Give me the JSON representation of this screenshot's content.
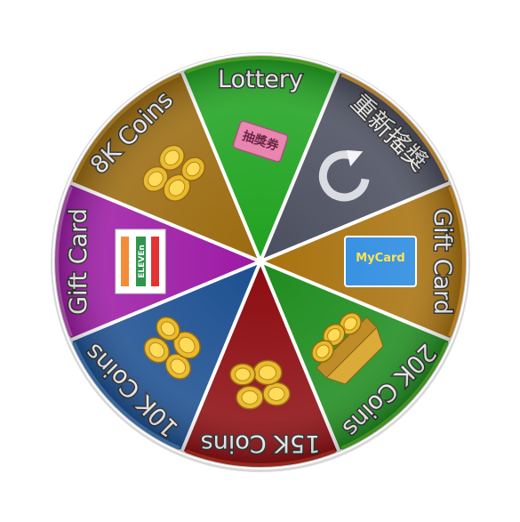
{
  "wheel": {
    "segments": [
      {
        "label": "Lottery",
        "color": "#1fa21f",
        "rim": "#5ac82a",
        "icon": "lottery-ticket-icon",
        "ticket_text": "抽獎券"
      },
      {
        "label": "重新搖獎",
        "color": "#4b4e5e",
        "rim": "#e0a040",
        "icon": "refresh-icon"
      },
      {
        "label": "Gift Card",
        "color": "#a8720e",
        "rim": "#e8a030",
        "icon": "mycard-icon",
        "card_text": "MyCard"
      },
      {
        "label": "20K Coins",
        "color": "#1e8c1e",
        "rim": "#56b82a",
        "icon": "gold-bar-coins-icon"
      },
      {
        "label": "15K Coins",
        "color": "#8c0c10",
        "rim": "#c03020",
        "icon": "coin-pile-icon"
      },
      {
        "label": "10K Coins",
        "color": "#1c4f90",
        "rim": "#4a84c8",
        "icon": "coin-stack-icon"
      },
      {
        "label": "Gift Card",
        "color": "#9c1aa4",
        "rim": "#c860c8",
        "icon": "seven-eleven-icon",
        "card_text": "ELEVEn"
      },
      {
        "label": "8K Coins",
        "color": "#9a6a0e",
        "rim": "#c8902a",
        "icon": "coins-icon"
      }
    ]
  }
}
